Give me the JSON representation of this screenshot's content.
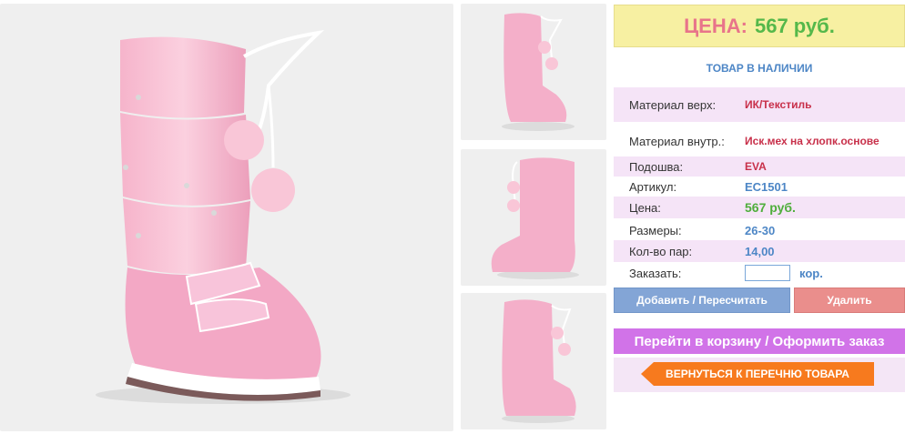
{
  "price_banner": {
    "label": "ЦЕНА:",
    "value": "567 руб."
  },
  "stock_status": "ТОВАР В НАЛИЧИИ",
  "specs": [
    {
      "key": "Материал верх:",
      "value": "ИК/Текстиль"
    },
    {
      "key": "Материал внутр.:",
      "value": "Иск.мех на хлопк.основе"
    },
    {
      "key": "Подошва:",
      "value": "EVA"
    },
    {
      "key": "Артикул:",
      "value": "EC1501"
    },
    {
      "key": "Цена:",
      "value": "567 руб."
    },
    {
      "key": "Размеры:",
      "value": "26-30"
    },
    {
      "key": "Кол-во пар:",
      "value": "14,00"
    }
  ],
  "order": {
    "label": "Заказать:",
    "value": "",
    "unit": "кор."
  },
  "buttons": {
    "add": "Добавить / Пересчитать",
    "delete": "Удалить",
    "cart": "Перейти в корзину / Оформить заказ",
    "back": "ВЕРНУТЬСЯ К ПЕРЕЧНЮ ТОВАРА"
  },
  "colors": {
    "price_banner_bg": "#f7f0a2",
    "label_pink": "#e8748a",
    "value_green": "#55b84a",
    "link_blue": "#4d86c6",
    "add_button": "#83a5d6",
    "delete_button": "#ea8e8c",
    "cart_button": "#d173e8",
    "back_button": "#f77a1e",
    "row_highlight": "#f5e4f7"
  },
  "images": {
    "main": "pink-winter-boot-main",
    "thumbnails": [
      "pink-boot-front-view",
      "pink-boot-side-view",
      "pink-boot-front-view-2"
    ]
  }
}
